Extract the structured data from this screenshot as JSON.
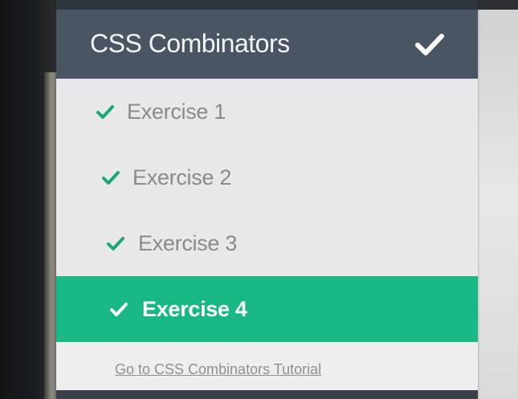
{
  "section": {
    "title": "CSS Combinators",
    "completed_icon": "check-icon"
  },
  "exercises": [
    {
      "label": "Exercise 1",
      "status": "completed"
    },
    {
      "label": "Exercise 2",
      "status": "completed"
    },
    {
      "label": "Exercise 3",
      "status": "completed"
    },
    {
      "label": "Exercise 4",
      "status": "completed",
      "active": true
    }
  ],
  "footer": {
    "tutorial_link": "Go to CSS Combinators Tutorial"
  },
  "colors": {
    "header_bg": "#4a5563",
    "active_bg": "#18b886",
    "check_green": "#1aa878",
    "text_muted": "#8a8a8c"
  }
}
